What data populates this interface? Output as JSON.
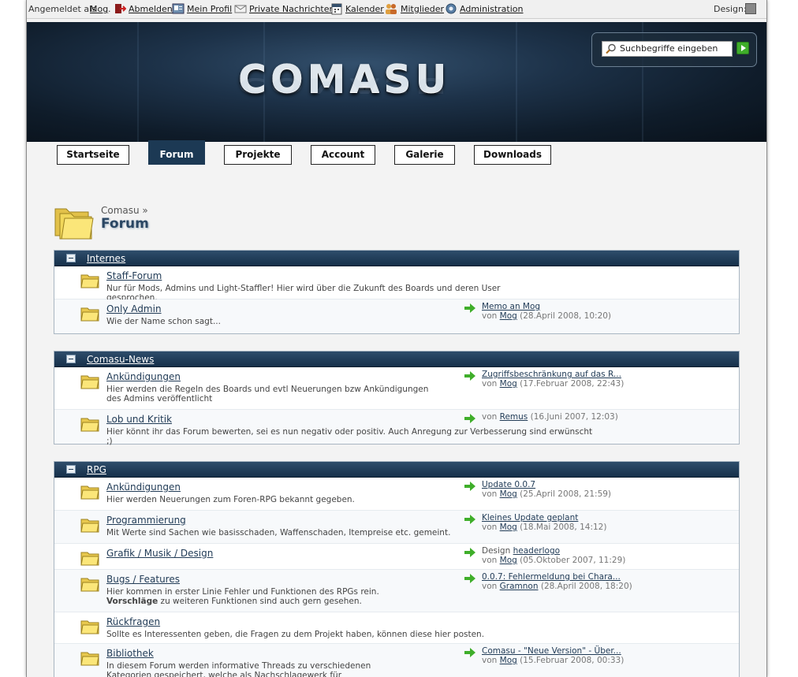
{
  "userbar": {
    "logged_in_prefix": "Angemeldet als",
    "username": "Mog",
    "links": [
      {
        "label": "Abmelden",
        "icon": "logout-icon"
      },
      {
        "label": "Mein Profil",
        "icon": "profile-icon"
      },
      {
        "label": "Private Nachrichten",
        "icon": "envelope-icon"
      },
      {
        "label": "Kalender",
        "icon": "calendar-icon"
      },
      {
        "label": "Mitglieder",
        "icon": "members-icon"
      },
      {
        "label": "Administration",
        "icon": "gear-icon"
      }
    ],
    "design_label": "Design:"
  },
  "header": {
    "logo_text": "COMASU",
    "search_placeholder": "Suchbegriffe eingeben"
  },
  "nav": {
    "tabs": [
      {
        "label": "Startseite",
        "active": false
      },
      {
        "label": "Forum",
        "active": true
      },
      {
        "label": "Projekte",
        "active": false
      },
      {
        "label": "Account",
        "active": false
      },
      {
        "label": "Galerie",
        "active": false
      },
      {
        "label": "Downloads",
        "active": false
      }
    ]
  },
  "breadcrumb": {
    "parent": "Comasu »",
    "title": "Forum"
  },
  "categories": [
    {
      "name": "Internes",
      "forums": [
        {
          "name": "Staff-Forum",
          "desc": "Nur für Mods, Admins und Light-Staffler! Hier wird über die Zukunft des Boards und deren User gesprochen.",
          "last_title": "",
          "last_prefix": "",
          "last_user": "",
          "last_date": ""
        },
        {
          "name": "Only Admin",
          "desc": "Wie der Name schon sagt...",
          "last_title": "Memo an Mog",
          "last_prefix": "von",
          "last_user": "Mog",
          "last_date": "(28.April 2008, 10:20)"
        }
      ]
    },
    {
      "name": "Comasu-News",
      "forums": [
        {
          "name": "Ankündigungen",
          "desc": "Hier werden die Regeln des Boards und evtl Neuerungen bzw Ankündigungen des Admins veröffentlicht",
          "last_title": "Zugriffsbeschränkung auf das R...",
          "last_prefix": "von",
          "last_user": "Mog",
          "last_date": "(17.Februar 2008, 22:43)"
        },
        {
          "name": "Lob und Kritik",
          "desc": "Hier könnt ihr das Forum bewerten, sei es nun negativ oder positiv. Auch Anregung zur Verbesserung sind erwünscht ;)",
          "last_title": "",
          "last_prefix": "von",
          "last_user": "Remus",
          "last_date": "(16.Juni 2007, 12:03)"
        }
      ]
    },
    {
      "name": "RPG",
      "forums": [
        {
          "name": "Ankündigungen",
          "desc": "Hier werden Neuerungen zum Foren-RPG bekannt gegeben.",
          "last_title": "Update 0.0.7",
          "last_prefix": "von",
          "last_user": "Mog",
          "last_date": "(25.April 2008, 21:59)"
        },
        {
          "name": "Programmierung",
          "desc": "Mit Werte sind Sachen wie basisschaden, Waffenschaden, Itempreise etc. gemeint.",
          "last_title": "Kleines Update geplant",
          "last_prefix": "von",
          "last_user": "Mog",
          "last_date": "(18.Mai 2008, 14:12)"
        },
        {
          "name": "Grafik / Musik / Design",
          "desc": "",
          "last_title_prefix": "Design",
          "last_title": "headerlogo",
          "last_prefix": "von",
          "last_user": "Mog",
          "last_date": "(05.Oktober 2007, 11:29)"
        },
        {
          "name": "Bugs / Features",
          "desc": "Hier kommen in erster Linie Fehler und Funktionen des RPGs rein.",
          "desc_bold": "Vorschläge",
          "desc2": " zu weiteren Funktionen sind auch gern gesehen.",
          "last_title": "0.0.7: Fehlermeldung bei Chara...",
          "last_prefix": "von",
          "last_user": "Gramnon",
          "last_date": "(28.April 2008, 18:20)"
        },
        {
          "name": "Rückfragen",
          "desc": "Sollte es Interessenten geben, die Fragen zu dem Projekt haben, können diese hier posten.",
          "last_title": "",
          "last_prefix": "",
          "last_user": "",
          "last_date": ""
        },
        {
          "name": "Bibliothek",
          "desc": "In diesem Forum werden informative Threads zu verschiedenen Kategorien gespeichert, welche als Nachschlagewerk für Programmierer gilt.",
          "last_title": "Comasu - \"Neue Version\" - Über...",
          "last_prefix": "von",
          "last_user": "Mog",
          "last_date": "(15.Februar 2008, 00:33)"
        }
      ]
    }
  ],
  "colors": {
    "header_bg": "#1d3249",
    "tab_active": "#1c3954",
    "cat_head": "#16304a",
    "link": "#223c57"
  }
}
